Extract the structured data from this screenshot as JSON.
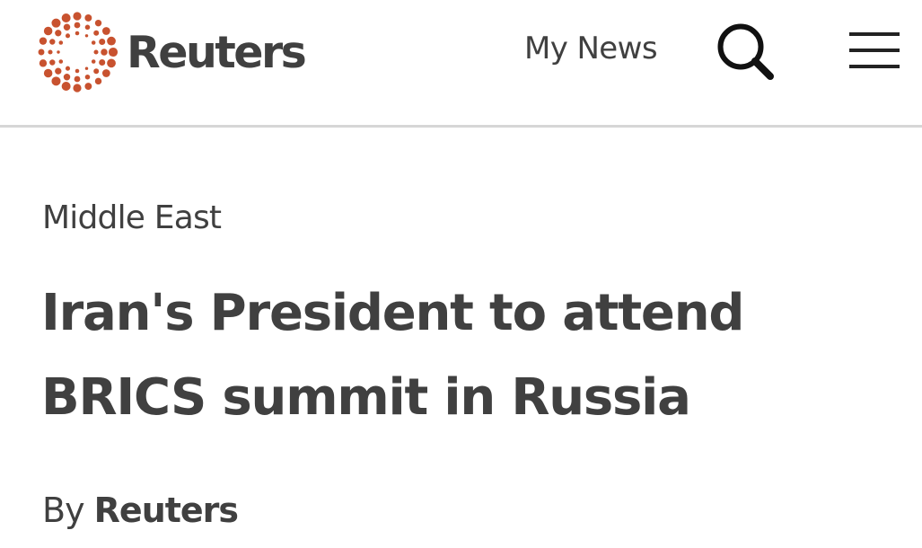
{
  "header": {
    "brand": "Reuters",
    "logo_icon": "reuters-dotted-circle-logo",
    "my_news_label": "My News",
    "search_icon": "search-icon",
    "menu_icon": "hamburger-menu-icon",
    "brand_color": "#c8522f",
    "text_color": "#404040",
    "divider_color": "#d6d6d6"
  },
  "article": {
    "section": "Middle East",
    "headline": "Iran's President to attend BRICS summit in Russia",
    "byline_prefix": "By",
    "byline_author": "Reuters"
  }
}
